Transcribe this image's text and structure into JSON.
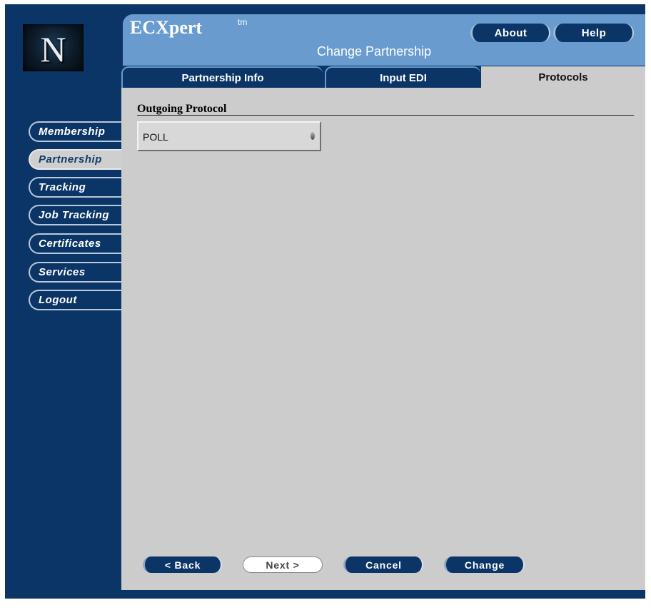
{
  "header": {
    "app_title": "ECXpert",
    "trademark": "tm",
    "subtitle": "Change Partnership",
    "about_label": "About",
    "help_label": "Help"
  },
  "logo": {
    "letter": "N"
  },
  "tabs": [
    {
      "label": "Partnership Info",
      "active": false
    },
    {
      "label": "Input EDI",
      "active": false
    },
    {
      "label": "Protocols",
      "active": true
    }
  ],
  "sidebar": {
    "items": [
      {
        "label": "Membership",
        "selected": false
      },
      {
        "label": "Partnership",
        "selected": true
      },
      {
        "label": "Tracking",
        "selected": false
      },
      {
        "label": "Job Tracking",
        "selected": false
      },
      {
        "label": "Certificates",
        "selected": false
      },
      {
        "label": "Services",
        "selected": false
      },
      {
        "label": "Logout",
        "selected": false
      }
    ]
  },
  "main": {
    "section_title": "Outgoing Protocol",
    "protocol_select": {
      "value": "POLL"
    }
  },
  "footer": {
    "back_label": "< Back",
    "next_label": "Next >",
    "cancel_label": "Cancel",
    "change_label": "Change"
  },
  "colors": {
    "frame": "#0a3566",
    "header": "#6a9bcf",
    "panel": "#cccccc"
  }
}
